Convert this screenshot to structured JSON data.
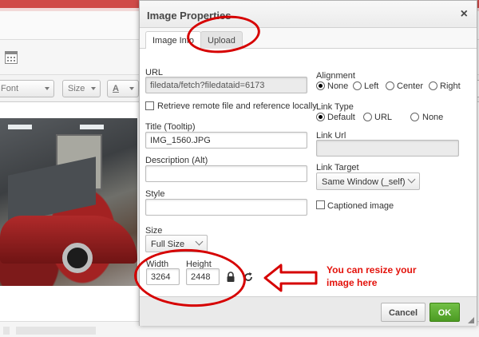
{
  "background": {
    "font_combo": "Font",
    "size_combo": "Size",
    "color_combo": "A"
  },
  "dialog": {
    "title": "Image Properties",
    "close_glyph": "×",
    "tabs": [
      {
        "label": "Image Info",
        "active": true
      },
      {
        "label": "Upload",
        "active": false
      }
    ],
    "url": {
      "label": "URL",
      "value": "filedata/fetch?filedataid=6173"
    },
    "retrieve_label": "Retrieve remote file and reference locally",
    "title_field": {
      "label": "Title (Tooltip)",
      "value": "IMG_1560.JPG"
    },
    "description": {
      "label": "Description (Alt)",
      "value": ""
    },
    "style": {
      "label": "Style",
      "value": ""
    },
    "size": {
      "label": "Size",
      "value": "Full Size"
    },
    "width": {
      "label": "Width",
      "value": "3264"
    },
    "height": {
      "label": "Height",
      "value": "2448"
    },
    "alignment": {
      "label": "Alignment",
      "options": [
        "None",
        "Left",
        "Center",
        "Right"
      ],
      "selected": "None"
    },
    "link_type": {
      "label": "Link Type",
      "options": [
        "Default",
        "URL",
        "None"
      ],
      "selected": "Default"
    },
    "link_url": {
      "label": "Link Url",
      "value": ""
    },
    "link_target": {
      "label": "Link Target",
      "value": "Same Window (_self)"
    },
    "captioned_label": "Captioned image",
    "cancel_label": "Cancel",
    "ok_label": "OK"
  },
  "annotation": {
    "text_line1": "You can resize your",
    "text_line2": "image here",
    "color": "#e3120b"
  },
  "colors": {
    "ok_button": "#5aab2e",
    "top_bar": "#d04b48"
  }
}
